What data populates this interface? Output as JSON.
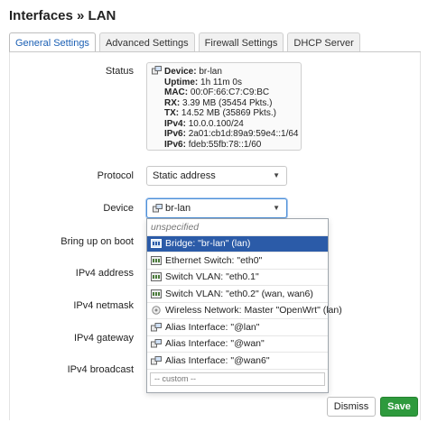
{
  "page": {
    "title": "Interfaces » LAN"
  },
  "tabs": [
    {
      "label": "General Settings",
      "active": true
    },
    {
      "label": "Advanced Settings",
      "active": false
    },
    {
      "label": "Firewall Settings",
      "active": false
    },
    {
      "label": "DHCP Server",
      "active": false
    }
  ],
  "status": {
    "label": "Status",
    "device": {
      "key": "Device:",
      "value": "br-lan"
    },
    "uptime": {
      "key": "Uptime:",
      "value": "1h 11m 0s"
    },
    "mac": {
      "key": "MAC:",
      "value": "00:0F:66:C7:C9:BC"
    },
    "rx": {
      "key": "RX:",
      "value": "3.39 MB (35454 Pkts.)"
    },
    "tx": {
      "key": "TX:",
      "value": "14.52 MB (35869 Pkts.)"
    },
    "ipv4": {
      "key": "IPv4:",
      "value": "10.0.0.100/24"
    },
    "ipv6_1": {
      "key": "IPv6:",
      "value": "2a01:cb1d:89a9:59e4::1/64"
    },
    "ipv6_2": {
      "key": "IPv6:",
      "value": "fdeb:55fb:78::1/60"
    }
  },
  "protocol": {
    "label": "Protocol",
    "value": "Static address"
  },
  "device": {
    "label": "Device",
    "value": "br-lan"
  },
  "labels": {
    "bring_up": "Bring up on boot",
    "ipv4_address": "IPv4 address",
    "ipv4_netmask": "IPv4 netmask",
    "ipv4_gateway": "IPv4 gateway",
    "ipv4_broadcast": "IPv4 broadcast"
  },
  "dropdown": {
    "options": [
      "unspecified",
      "Bridge: \"br-lan\" (lan)",
      "Ethernet Switch: \"eth0\"",
      "Switch VLAN: \"eth0.1\"",
      "Switch VLAN: \"eth0.2\" (wan, wan6)",
      "Wireless Network: Master \"OpenWrt\" (lan)",
      "Alias Interface: \"@lan\"",
      "Alias Interface: \"@wan\"",
      "Alias Interface: \"@wan6\""
    ],
    "selected_index": 1,
    "custom_placeholder": "-- custom --"
  },
  "buttons": {
    "dismiss": "Dismiss",
    "save": "Save"
  },
  "colors": {
    "selected_bg": "#2b5ba8",
    "save_bg": "#2e9a3d",
    "active_tab": "#1a5fb4"
  }
}
